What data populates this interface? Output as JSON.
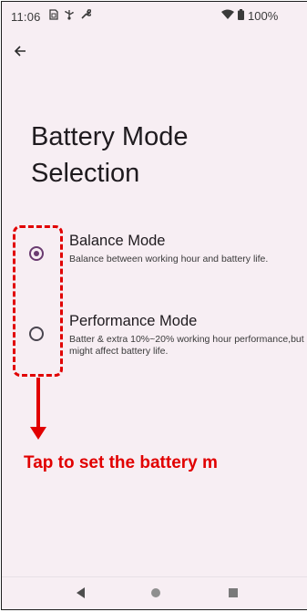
{
  "status_bar": {
    "time": "11:06",
    "left_icons": [
      "sim-icon",
      "usb-icon",
      "wrench-icon"
    ],
    "right_icons": [
      "wifi-icon",
      "battery-icon"
    ],
    "battery_text": "100%"
  },
  "header": {
    "back_icon": "arrow-left-icon"
  },
  "page": {
    "title": "Battery Mode Selection"
  },
  "options": [
    {
      "label": "Balance Mode",
      "description": "Balance between working hour and battery life.",
      "selected": true
    },
    {
      "label": "Performance Mode",
      "description": "Batter & extra 10%~20% working hour performance,but might affect battery life.",
      "selected": false
    }
  ],
  "annotation": {
    "text": "Tap to set the battery m",
    "color": "#e10000"
  },
  "nav_bar": {
    "icons": [
      "nav-back-icon",
      "nav-home-icon",
      "nav-recents-icon"
    ]
  },
  "colors": {
    "background": "#f7eef3",
    "accent": "#6a3b70",
    "annotation": "#e10000"
  }
}
